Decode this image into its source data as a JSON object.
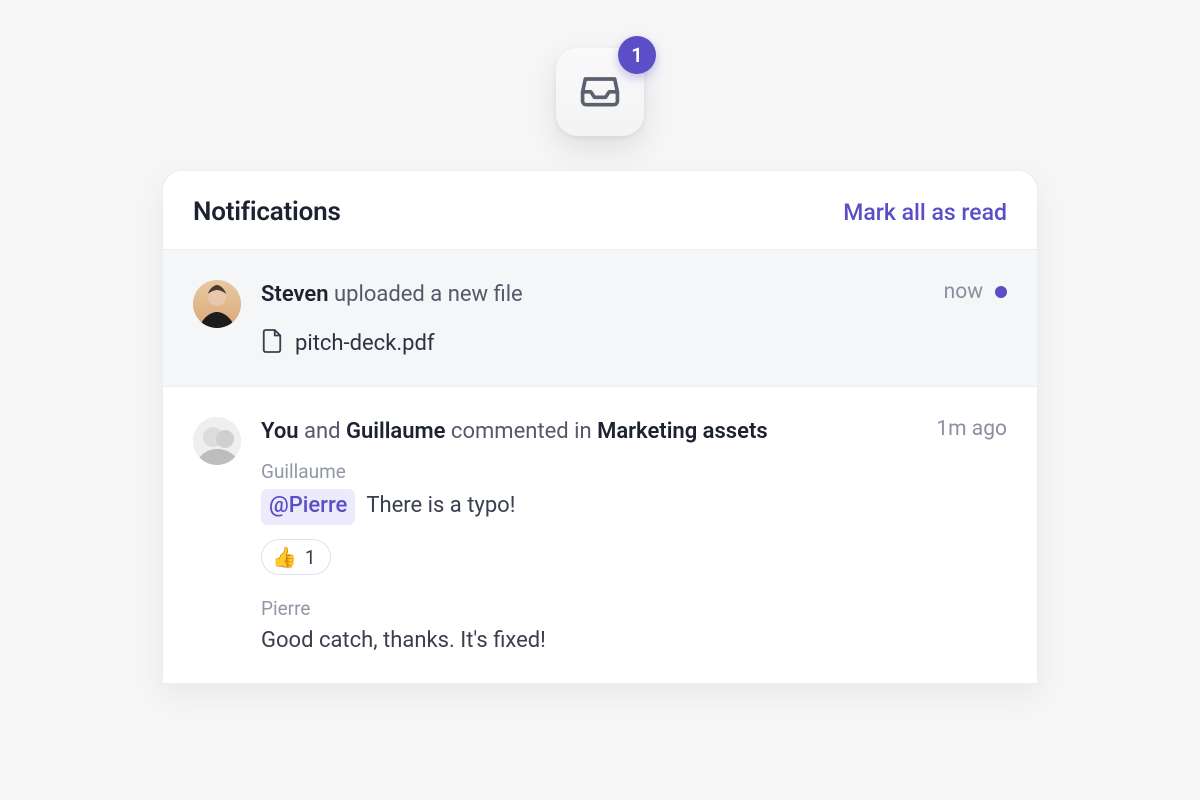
{
  "colors": {
    "accent": "#5b4ec7"
  },
  "inbox": {
    "badge_count": "1",
    "icon": "inbox-icon"
  },
  "panel": {
    "title": "Notifications",
    "mark_all_label": "Mark all as read"
  },
  "notifications": [
    {
      "unread": true,
      "time": "now",
      "avatar": "steven",
      "title_parts": {
        "a": "Steven",
        "b": " uploaded a new file"
      },
      "attachment": {
        "filename": "pitch-deck.pdf"
      }
    },
    {
      "unread": false,
      "time": "1m ago",
      "avatar": "guillaume",
      "title_parts": {
        "a": "You",
        "b": " and ",
        "c": "Guillaume",
        "d": " commented in ",
        "e": "Marketing assets"
      },
      "comments": [
        {
          "author": "Guillaume",
          "mention": "@Pierre",
          "text": " There is a typo!",
          "reaction": {
            "emoji": "👍",
            "count": "1"
          }
        },
        {
          "author": "Pierre",
          "text": "Good catch, thanks. It's fixed!"
        }
      ]
    }
  ]
}
